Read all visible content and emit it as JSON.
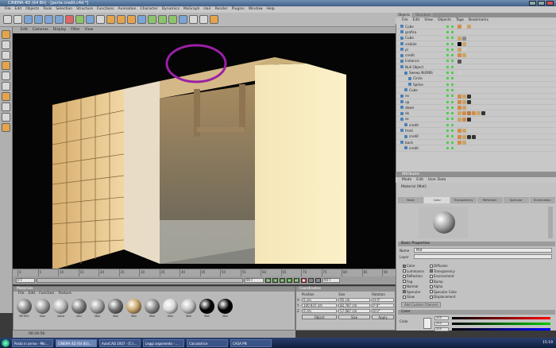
{
  "window": {
    "title": "CINEMA 4D (64 Bit) - [porta credit.c4d *]"
  },
  "menu": [
    "File",
    "Edit",
    "Objects",
    "Tools",
    "Selection",
    "Structure",
    "Functions",
    "Animation",
    "Character",
    "Dynamics",
    "MoGraph",
    "Hair",
    "Render",
    "Plugins",
    "Window",
    "Help"
  ],
  "toolbar_icons": [
    "undo-icon",
    "redo-icon",
    "live-select-icon",
    "move-icon",
    "scale-icon",
    "rotate-icon",
    "axis-x-icon",
    "axis-y-icon",
    "axis-z-icon",
    "world-icon",
    "render-view-icon",
    "render-picture-icon",
    "render-settings-icon",
    "cube-icon",
    "pen-icon",
    "nurbs-icon",
    "array-icon",
    "deformer-icon",
    "scene-icon",
    "camera-icon",
    "light-icon"
  ],
  "left_tools": [
    "model-tool-icon",
    "object-tool-icon",
    "texture-tool-icon",
    "axis-tool-icon",
    "point-tool-icon",
    "edge-tool-icon",
    "polygon-tool-icon",
    "tweak-tool-icon",
    "snap-icon",
    "workplane-icon"
  ],
  "viewport": {
    "menu": [
      "Edit",
      "Cameras",
      "Display",
      "Filter",
      "View"
    ]
  },
  "timeline": {
    "ticks": [
      "0",
      "5",
      "10",
      "15",
      "20",
      "25",
      "30",
      "35",
      "40",
      "45",
      "50",
      "55",
      "60",
      "65",
      "70",
      "75",
      "80",
      "85",
      "90"
    ],
    "start": "0 F",
    "current": "90 F",
    "end": "90 F"
  },
  "materials": {
    "title": "Materials",
    "menu": [
      "File",
      "Edit",
      "Function",
      "Texture"
    ],
    "items": [
      {
        "name": "RETRO",
        "color": "#888888"
      },
      {
        "name": "Mat",
        "color": "#9a9a9a"
      },
      {
        "name": "vetro",
        "color": "#b5b5b5"
      },
      {
        "name": "allu",
        "color": "#7f7f7f"
      },
      {
        "name": "Mat",
        "color": "#a0a0a0"
      },
      {
        "name": "Mat",
        "color": "#6f6f6f"
      },
      {
        "name": "Mat",
        "color": "#c9a468"
      },
      {
        "name": "Mat",
        "color": "#8a8a8a"
      },
      {
        "name": "Mat",
        "color": "#d8d8d8"
      },
      {
        "name": "Mat",
        "color": "#c0c0c0"
      },
      {
        "name": "Mat",
        "color": "#000000"
      },
      {
        "name": "Mat",
        "color": "#000000"
      }
    ]
  },
  "status": {
    "time": "00:34:56"
  },
  "coords": {
    "title": "Coordinates",
    "headers": [
      "Position",
      "Size",
      "Rotation"
    ],
    "rows": [
      {
        "axis": "X",
        "pos": "0 cm",
        "size": "95 cm",
        "rot": "H  0°"
      },
      {
        "axis": "Y",
        "pos": "100.937 cm",
        "size": "82.787 cm",
        "rot": "P  0°"
      },
      {
        "axis": "Z",
        "pos": "0 cm",
        "size": "57.087 cm",
        "rot": "B  0°"
      }
    ],
    "mode1": "Object",
    "mode2": "Size",
    "apply": "Apply"
  },
  "objects": {
    "tabs": [
      "Objects",
      "Structure"
    ],
    "menu": [
      "File",
      "Edit",
      "View",
      "Objects",
      "Tags",
      "Bookmarks"
    ],
    "items": [
      {
        "name": "Cube",
        "indent": 1,
        "tags": [
          "#d48a4a",
          "#cccccc",
          "#c9a468"
        ]
      },
      {
        "name": "grafica",
        "indent": 1,
        "tags": []
      },
      {
        "name": "Cube",
        "indent": 1,
        "tags": [
          "#c9a468",
          "#8a8a8a"
        ]
      },
      {
        "name": "visibile",
        "indent": 1,
        "tags": [
          "#000000",
          "#c9a468"
        ]
      },
      {
        "name": "pl",
        "indent": 1,
        "tags": [
          "#c9a468",
          "#cccccc"
        ]
      },
      {
        "name": "credit",
        "indent": 1,
        "tags": [
          "#d48a4a",
          "#c9a468"
        ]
      },
      {
        "name": "Instance",
        "indent": 1,
        "tags": [
          "#555555"
        ]
      },
      {
        "name": "Null Object",
        "indent": 1,
        "tags": []
      },
      {
        "name": "Sweep NURBS",
        "indent": 2,
        "tags": [
          "#cccccc"
        ]
      },
      {
        "name": "Circle",
        "indent": 3,
        "tags": []
      },
      {
        "name": "Spline",
        "indent": 3,
        "tags": []
      },
      {
        "name": "Cube",
        "indent": 2,
        "tags": []
      },
      {
        "name": "ex",
        "indent": 1,
        "tags": [
          "#d48a4a",
          "#c9a468",
          "#333333"
        ]
      },
      {
        "name": "up",
        "indent": 1,
        "tags": [
          "#d48a4a",
          "#c9a468",
          "#333333"
        ]
      },
      {
        "name": "down",
        "indent": 1,
        "tags": [
          "#d48a4a",
          "#c9a468"
        ]
      },
      {
        "name": "dx",
        "indent": 1,
        "tags": [
          "#c9a468",
          "#d48a4a",
          "#b08040",
          "#d48a4a",
          "#c9a468",
          "#333333"
        ]
      },
      {
        "name": "sx",
        "indent": 1,
        "tags": [
          "#c9a468",
          "#d48a4a",
          "#333333"
        ]
      },
      {
        "name": "credit",
        "indent": 2,
        "tags": []
      },
      {
        "name": "front",
        "indent": 1,
        "tags": [
          "#d48a4a",
          "#c9a468"
        ]
      },
      {
        "name": "credit",
        "indent": 2,
        "tags": [
          "#d48a4a",
          "#c9a468",
          "#333333",
          "#333333"
        ]
      },
      {
        "name": "back",
        "indent": 1,
        "tags": [
          "#d48a4a",
          "#c9a468"
        ]
      },
      {
        "name": "credit",
        "indent": 2,
        "tags": []
      }
    ]
  },
  "attributes": {
    "title": "Attributes",
    "menu": [
      "Mode",
      "Edit",
      "User Data"
    ],
    "material_label": "Material [Mat]",
    "tabs": [
      "Basic",
      "Color",
      "Transparency",
      "Reflection",
      "Specular",
      "Illumination"
    ],
    "active_tab": "Color",
    "basic_header": "Basic Properties",
    "name_label": "Name",
    "name_value": "Mat",
    "layer_label": "Layer",
    "channels_left": [
      {
        "label": "Color",
        "on": true
      },
      {
        "label": "Luminance",
        "on": false
      },
      {
        "label": "Reflection",
        "on": false
      },
      {
        "label": "Fog",
        "on": false
      },
      {
        "label": "Normal",
        "on": false
      },
      {
        "label": "Specular",
        "on": true
      },
      {
        "label": "Glow",
        "on": false
      }
    ],
    "channels_right": [
      {
        "label": "Diffusion",
        "on": false
      },
      {
        "label": "Transparency",
        "on": true
      },
      {
        "label": "Environment",
        "on": false
      },
      {
        "label": "Bump",
        "on": false
      },
      {
        "label": "Alpha",
        "on": false
      },
      {
        "label": "Specular Color",
        "on": false
      },
      {
        "label": "Displacement",
        "on": false
      }
    ],
    "add_button": "Add Custom Channel",
    "color_header": "Color",
    "color_label": "Color",
    "rgb": [
      "255",
      "255",
      "255"
    ]
  },
  "taskbar": {
    "tasks": [
      "Posta in arrivo - Mic...",
      "CINEMA 4D (64 Bit)...",
      "AutoCAD 2007 - [C:\\...",
      "Leggi argomento - ...",
      "Calcolatrice",
      "CASA PN"
    ],
    "active": 1,
    "clock": "15:19"
  }
}
